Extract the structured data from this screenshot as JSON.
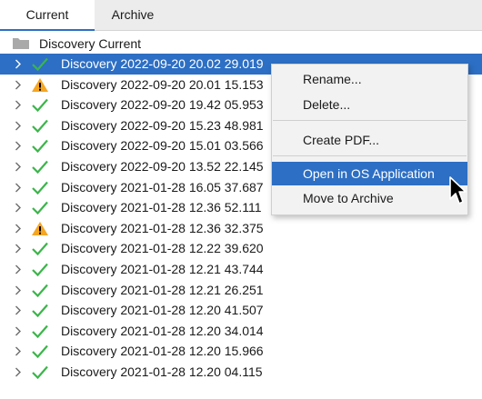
{
  "tabs": [
    {
      "label": "Current",
      "active": true
    },
    {
      "label": "Archive",
      "active": false
    }
  ],
  "tree": {
    "folder": {
      "label": "Discovery Current",
      "icon": "folder-icon"
    },
    "items": [
      {
        "label": "Discovery 2022-09-20 20.02 29.019",
        "status": "ok",
        "selected": true
      },
      {
        "label": "Discovery 2022-09-20 20.01 15.153",
        "status": "warning"
      },
      {
        "label": "Discovery 2022-09-20 19.42 05.953",
        "status": "ok"
      },
      {
        "label": "Discovery 2022-09-20 15.23 48.981",
        "status": "ok"
      },
      {
        "label": "Discovery 2022-09-20 15.01 03.566",
        "status": "ok"
      },
      {
        "label": "Discovery 2022-09-20 13.52 22.145",
        "status": "ok"
      },
      {
        "label": "Discovery 2021-01-28 16.05 37.687",
        "status": "ok"
      },
      {
        "label": "Discovery 2021-01-28 12.36 52.111",
        "status": "ok"
      },
      {
        "label": "Discovery 2021-01-28 12.36 32.375",
        "status": "warning"
      },
      {
        "label": "Discovery 2021-01-28 12.22 39.620",
        "status": "ok"
      },
      {
        "label": "Discovery 2021-01-28 12.21 43.744",
        "status": "ok"
      },
      {
        "label": "Discovery 2021-01-28 12.21 26.251",
        "status": "ok"
      },
      {
        "label": "Discovery 2021-01-28 12.20 41.507",
        "status": "ok"
      },
      {
        "label": "Discovery 2021-01-28 12.20 34.014",
        "status": "ok"
      },
      {
        "label": "Discovery 2021-01-28 12.20 15.966",
        "status": "ok"
      },
      {
        "label": "Discovery 2021-01-28 12.20 04.115",
        "status": "ok"
      }
    ]
  },
  "context_menu": {
    "items": [
      {
        "label": "Rename..."
      },
      {
        "label": "Delete..."
      },
      {
        "label": "Create PDF..."
      },
      {
        "label": "Open in OS Application",
        "highlighted": true
      },
      {
        "label": "Move to Archive"
      }
    ]
  },
  "colors": {
    "selection": "#2d6fc4",
    "check": "#3bb54a",
    "warning": "#f5a623",
    "folder": "#a9a9a9"
  }
}
